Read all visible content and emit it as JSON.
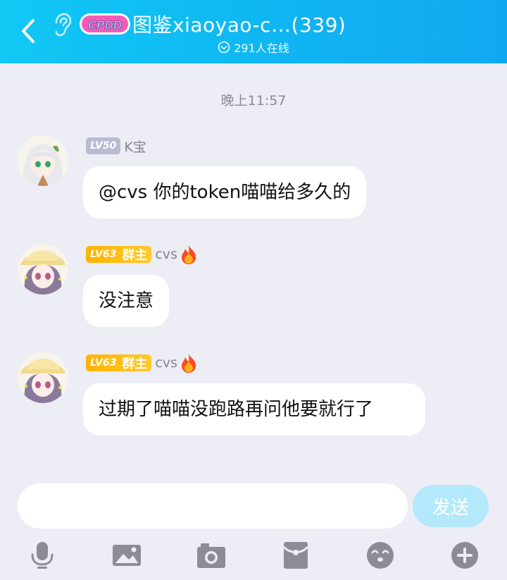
{
  "header": {
    "title": "图鉴xiaoyao-c…(339)",
    "online": "291人在线",
    "badge_text": "CPDD"
  },
  "time_divider": "晚上11:57",
  "messages": [
    {
      "level": "LV50",
      "role": "",
      "nickname": "K宝",
      "text": "@cvs 你的token喵喵给多久的"
    },
    {
      "level": "LV63",
      "role": "群主",
      "nickname": "cvs",
      "text": "没注意"
    },
    {
      "level": "LV63",
      "role": "群主",
      "nickname": "cvs",
      "text": "过期了喵喵没跑路再问他要就行了"
    }
  ],
  "input": {
    "placeholder": "",
    "send_label": "发送"
  },
  "toolbar": [
    "mic-icon",
    "image-icon",
    "camera-icon",
    "red-packet-icon",
    "emoji-icon",
    "plus-icon"
  ],
  "colors": {
    "header": "#12b8f2",
    "background": "#ededf5",
    "send_disabled": "#b4e9fb",
    "level_gold": "#ffb400"
  }
}
